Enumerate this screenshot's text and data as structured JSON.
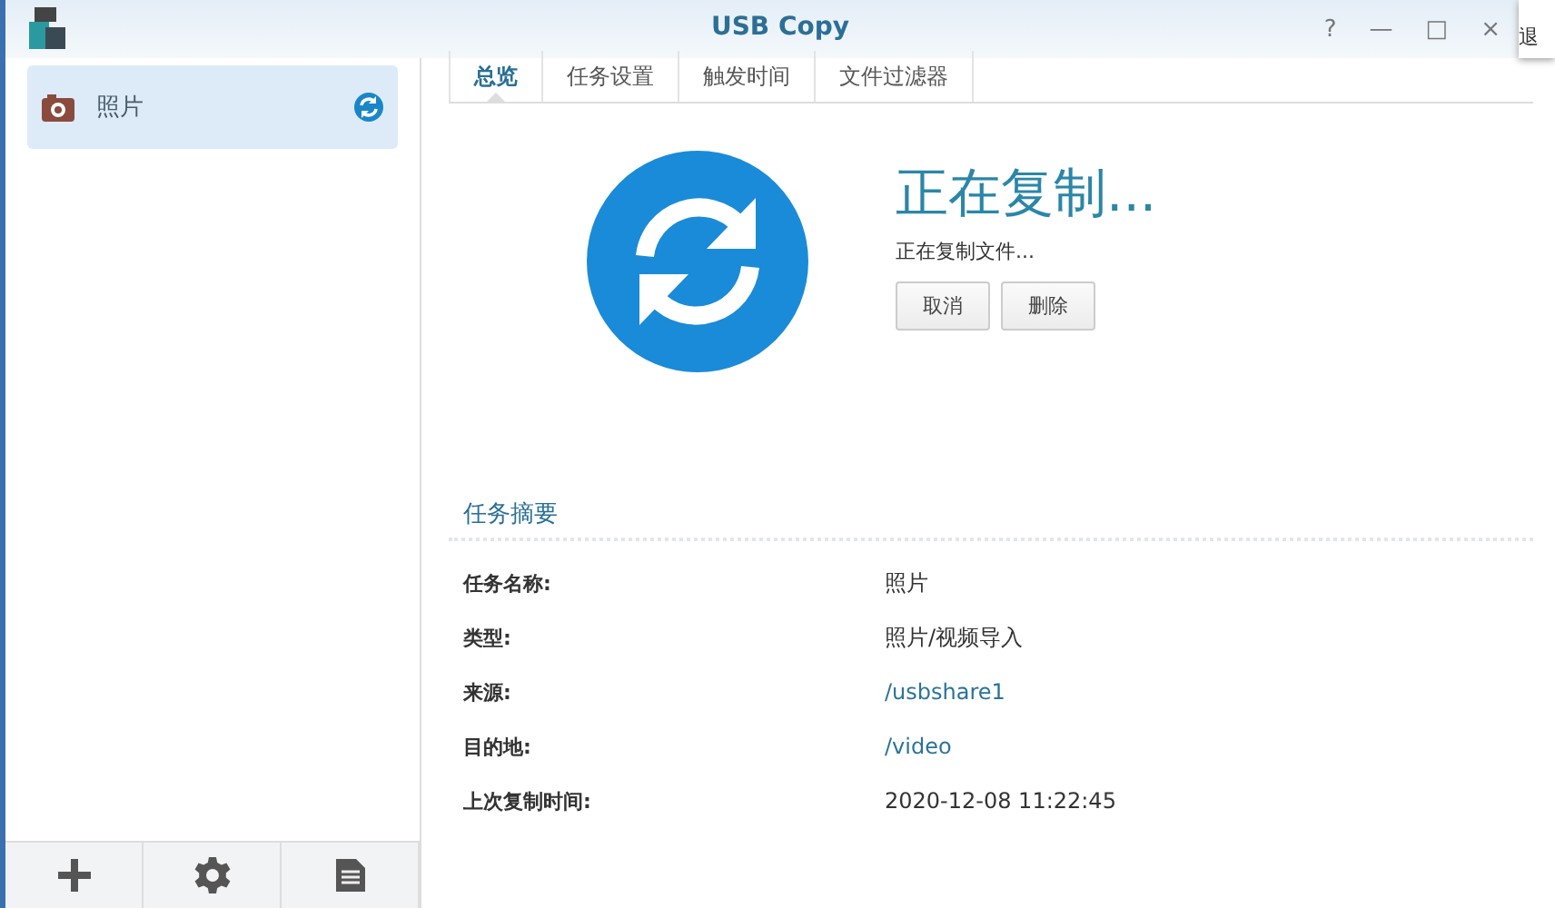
{
  "window": {
    "title": "USB Copy",
    "controls": [
      "?",
      "—",
      "□",
      "×"
    ]
  },
  "popup_text": "退",
  "sidebar": {
    "items": [
      {
        "label": "照片",
        "selected": true,
        "syncing": true
      }
    ]
  },
  "toolbar": [
    {
      "kind": "add"
    },
    {
      "kind": "settings"
    },
    {
      "kind": "log"
    }
  ],
  "tabs": [
    {
      "label": "总览",
      "selected": true
    },
    {
      "label": "任务设置",
      "selected": false
    },
    {
      "label": "触发时间",
      "selected": false
    },
    {
      "label": "文件过滤器",
      "selected": false
    }
  ],
  "status": {
    "title": "正在复制...",
    "subtitle": "正在复制文件...",
    "buttons": [
      "取消",
      "删除"
    ]
  },
  "summary": {
    "heading": "任务摘要",
    "rows": [
      {
        "label": "任务名称:",
        "value": "照片",
        "link": false
      },
      {
        "label": "类型:",
        "value": "照片/视频导入",
        "link": false
      },
      {
        "label": "来源:",
        "value": "/usbshare1",
        "link": true
      },
      {
        "label": "目的地:",
        "value": "/video",
        "link": true
      },
      {
        "label": "上次复制时间:",
        "value": "2020-12-08 11:22:45",
        "link": false
      }
    ]
  }
}
